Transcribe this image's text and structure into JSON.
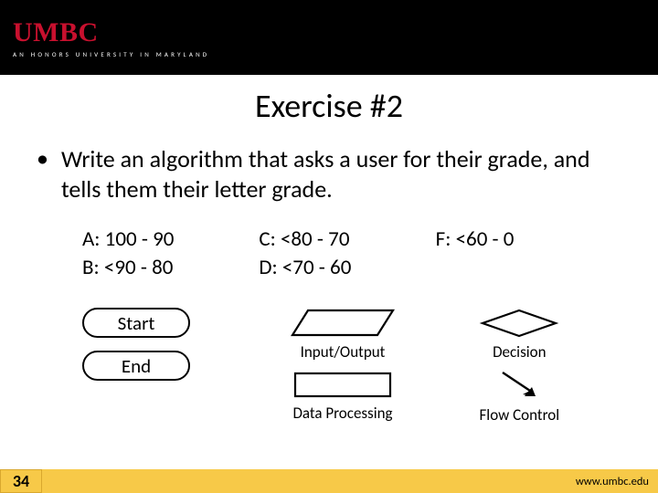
{
  "header": {
    "logo": "UMBC",
    "tagline": "AN HONORS UNIVERSITY IN MARYLAND"
  },
  "title": "Exercise #2",
  "bullet": "Write an algorithm that asks a user for their grade, and tells them their letter grade.",
  "grades": {
    "a": "A: 100 - 90",
    "b": "B: <90 - 80",
    "c": "C: <80 - 70",
    "d": "D: <70 - 60",
    "f": "F: <60 - 0"
  },
  "symbols": {
    "start": "Start",
    "end": "End",
    "io": "Input/Output",
    "proc": "Data Processing",
    "decision": "Decision",
    "flow": "Flow Control"
  },
  "footer": {
    "page": "34",
    "url": "www.umbc.edu"
  }
}
